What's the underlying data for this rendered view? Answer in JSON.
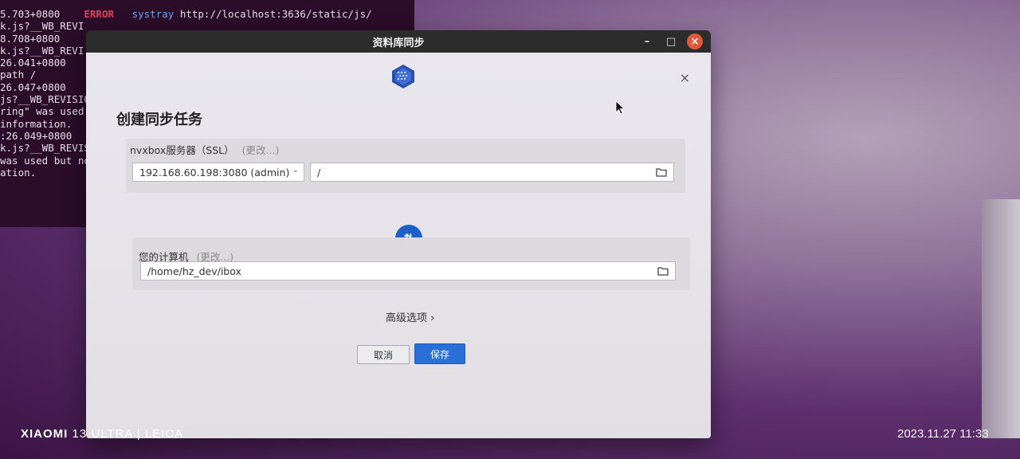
{
  "terminal": {
    "lines": [
      {
        "t1": "5.703+0800",
        "err": "ERROR",
        "sys": "systray",
        "rest": "http://localhost:3636/static/js/"
      },
      {
        "t1": "k.js?__WB_REVI",
        "err": "",
        "sys": "",
        "rest": ""
      },
      {
        "t1": "",
        "err": "",
        "sys": "",
        "rest": ""
      },
      {
        "t1": "8.708+0800",
        "err": "",
        "sys": "",
        "rest": ""
      },
      {
        "t1": "k.js?__WB_REVI",
        "err": "",
        "sys": "",
        "rest": ""
      },
      {
        "t1": "",
        "err": "",
        "sys": "",
        "rest": ""
      },
      {
        "t1": "26.041+0800",
        "err": "",
        "sys": "",
        "rest": ""
      },
      {
        "t1": "path /",
        "err": "",
        "sys": "",
        "rest": ""
      },
      {
        "t1": "26.047+0800",
        "err": "",
        "sys": "",
        "rest": ""
      },
      {
        "t1": "js?__WB_REVISIO",
        "err": "",
        "sys": "",
        "rest": ""
      },
      {
        "t1": "ring\" was used b",
        "err": "",
        "sys": "",
        "rest": ""
      },
      {
        "t1": "information.",
        "err": "",
        "sys": "",
        "rest": ""
      },
      {
        "t1": ":26.049+0800",
        "err": "",
        "sys": "",
        "rest": ""
      },
      {
        "t1": "k.js?__WB_REVISIO",
        "err": "",
        "sys": "",
        "rest": ""
      },
      {
        "t1": "was used but not",
        "err": "",
        "sys": "",
        "rest": ""
      },
      {
        "t1": "ation.",
        "err": "",
        "sys": "",
        "rest": ""
      }
    ]
  },
  "window": {
    "title": "资料库同步",
    "minimize": "–",
    "maximize": "□",
    "close": "×"
  },
  "dialog": {
    "close": "×",
    "heading": "创建同步任务",
    "server": {
      "label": "nvxbox服务器（SSL）",
      "change": "(更改...)",
      "selected": "192.168.60.198:3080 (admin)",
      "path": "/"
    },
    "local": {
      "label": "您的计算机",
      "change": "(更改...)",
      "path": "/home/hz_dev/ibox"
    },
    "swap_icon": "⇅",
    "advanced": "高级选项 ›",
    "cancel": "取消",
    "save": "保存"
  },
  "caption": {
    "brand": "XIAOMI",
    "model": "13 ULTRA | LEICA",
    "datetime": "2023.11.27   11:33"
  },
  "colors": {
    "primary": "#2a6fd8",
    "swap": "#1f5fc9",
    "error": "#e0415b"
  }
}
